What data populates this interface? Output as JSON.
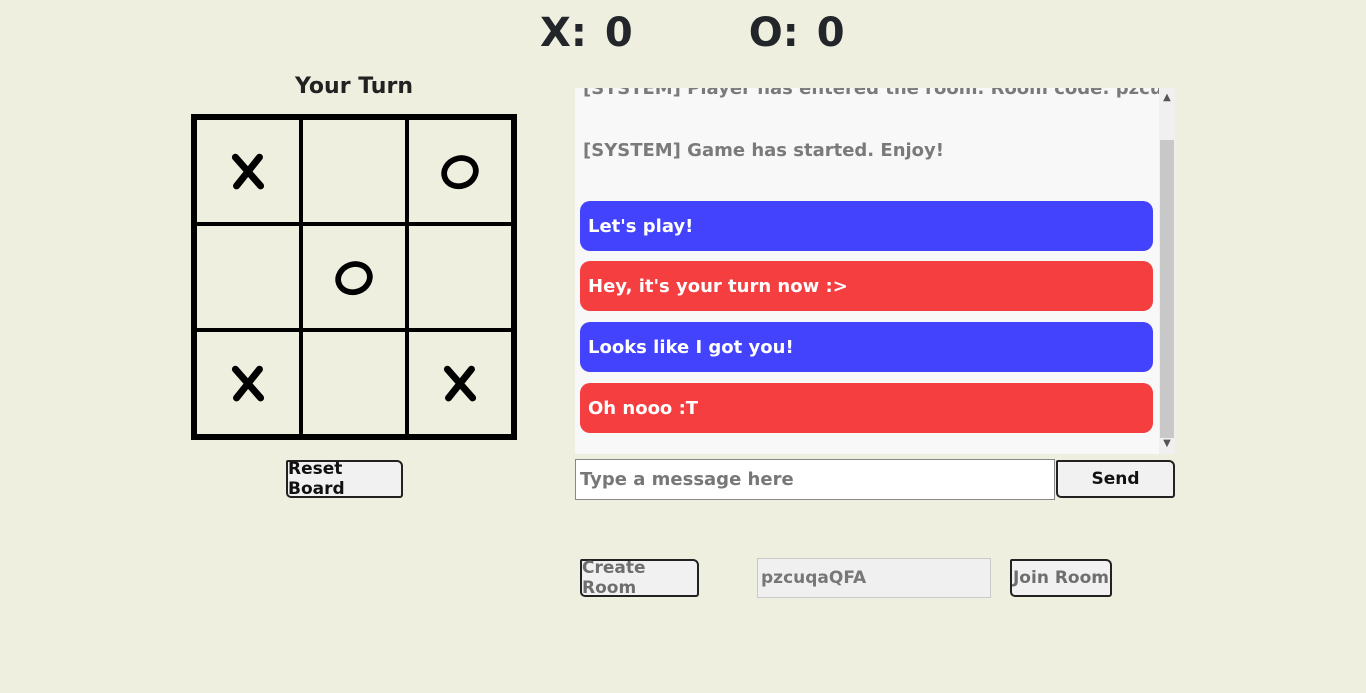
{
  "score": {
    "x_label": "X:",
    "x_value": "0",
    "o_label": "O:",
    "o_value": "0"
  },
  "turn_label": "Your Turn",
  "board": {
    "cells": [
      "X",
      "",
      "O",
      "",
      "O",
      "",
      "X",
      "",
      "X"
    ]
  },
  "reset_label": "Reset Board",
  "chat": {
    "system_top": "[SYSTEM] Player has entered the room. Room code: pzcuqaQFA",
    "system_main": "[SYSTEM] Game has started. Enjoy!",
    "messages": [
      {
        "text": "Let's play!",
        "color": "#4343fd"
      },
      {
        "text": "Hey, it's your turn now :>",
        "color": "#f53e40"
      },
      {
        "text": "Looks like I got you!",
        "color": "#4343fd"
      },
      {
        "text": "Oh nooo :T",
        "color": "#f53e40"
      }
    ]
  },
  "message_input": {
    "placeholder": "Type a message here",
    "value": ""
  },
  "send_label": "Send",
  "create_room_label": "Create Room",
  "room_code_value": "pzcuqaQFA",
  "join_room_label": "Join Room"
}
